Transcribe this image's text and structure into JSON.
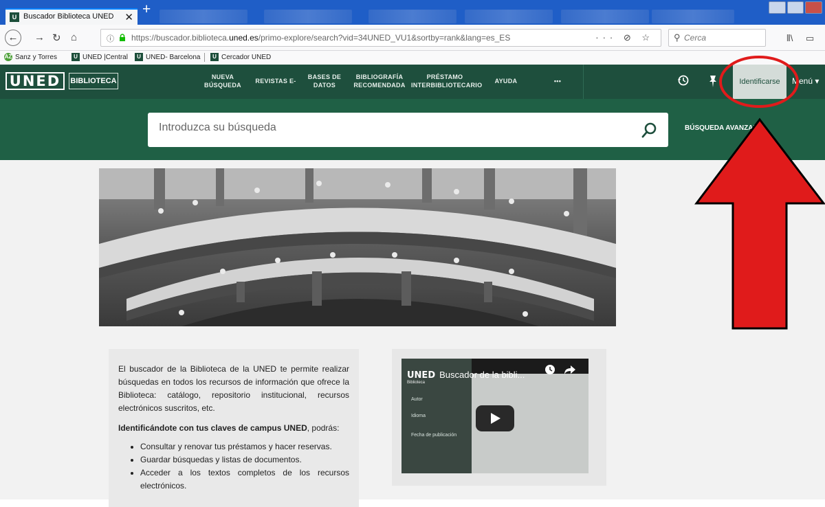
{
  "browser": {
    "active_tab": {
      "title": "Buscador Biblioteca UNED",
      "favicon": "U",
      "close": "✕"
    },
    "new_tab": "+",
    "url": {
      "prefix": "https://buscador.biblioteca.",
      "domain": "uned.es",
      "suffix": "/primo-explore/search?vid=34UNED_VU1&sortby=rank&lang=es_ES"
    },
    "url_actions": "··· ⊘ ☆",
    "search_placeholder": "Cerca",
    "bookmarks": [
      {
        "label": "Sanz y Torres",
        "icon": "green-circle-icon"
      },
      {
        "label": "UNED |Central",
        "icon": "uned-favicon"
      },
      {
        "label": "UNED- Barcelona",
        "icon": "uned-favicon"
      },
      {
        "label": "Cercador UNED",
        "icon": "uned-favicon"
      }
    ]
  },
  "site": {
    "logo": "UNED",
    "logo_sub": "BIBLIOTECA",
    "menu": [
      {
        "line1": "NUEVA",
        "line2": "BÚSQUEDA"
      },
      {
        "line1": "REVISTAS E-",
        "line2": ""
      },
      {
        "line1": "BASES DE",
        "line2": "DATOS"
      },
      {
        "line1": "BIBLIOGRAFÍA",
        "line2": "RECOMENDADA"
      },
      {
        "line1": "PRÉSTAMO",
        "line2": "INTERBIBLIOTECARIO"
      },
      {
        "line1": "AYUDA",
        "line2": ""
      },
      {
        "line1": "•••",
        "line2": ""
      }
    ],
    "login": "Identificarse",
    "menu_label": "Menú",
    "search_placeholder": "Introduzca su búsqueda",
    "advanced_search": "BÚSQUEDA AVANZADA"
  },
  "info": {
    "intro": "El buscador de la Biblioteca de la UNED te permite realizar búsquedas en todos los recursos de información que ofrece la Biblioteca: catálogo, repositorio institucional, recursos electrónicos suscritos, etc.",
    "login_bold": "Identificándote con tus claves de campus UNED",
    "login_rest": ", podrás:",
    "bullets": [
      "Consultar y renovar tus préstamos y hacer reservas.",
      "Guardar búsquedas y listas de documentos.",
      "Acceder a los textos completos de los recursos electrónicos."
    ]
  },
  "video": {
    "logo": "UNED",
    "title": "Buscador de la bibli...",
    "subtitle": "Biblioteca",
    "side_items": [
      "Autor",
      "Idioma",
      "Fecha de publicación"
    ]
  },
  "colors": {
    "header": "#1e4f3d",
    "search_band": "#1f6045",
    "annotation": "#e01b1b"
  }
}
